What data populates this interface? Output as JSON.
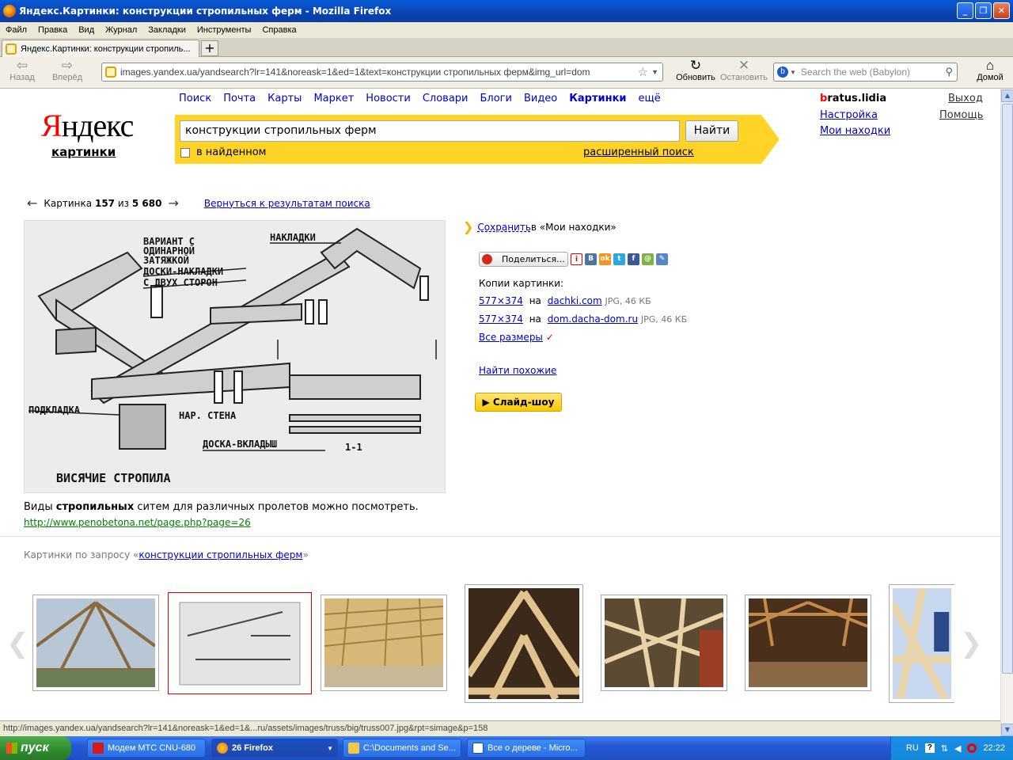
{
  "window": {
    "title": "Яндекс.Картинки: конструкции стропильных ферм - Mozilla Firefox",
    "controls": [
      "_",
      "❐",
      "✕"
    ]
  },
  "menu": [
    "Файл",
    "Правка",
    "Вид",
    "Журнал",
    "Закладки",
    "Инструменты",
    "Справка"
  ],
  "tab": {
    "label": "Яндекс.Картинки: конструкции стропиль...",
    "new_tab": "+"
  },
  "nav": {
    "back": "Назад",
    "forward": "Вперёд",
    "url": "images.yandex.ua/yandsearch?lr=141&noreask=1&ed=1&text=конструкции стропильных ферм&img_url=dom",
    "reload": "Обновить",
    "stop": "Остановить",
    "search_placeholder": "Search the web (Babylon)",
    "home": "Домой"
  },
  "yandex": {
    "logo_first": "Я",
    "logo_rest": "ндекс",
    "service": "картинки",
    "nav_links": [
      "Поиск",
      "Почта",
      "Карты",
      "Маркет",
      "Новости",
      "Словари",
      "Блоги",
      "Видео",
      "Картинки",
      "ещё"
    ],
    "query": "конструкции стропильных ферм",
    "search_button": "Найти",
    "in_found": "в найденном",
    "advanced": "расширенный поиск",
    "user_first": "b",
    "user_rest": "ratus.lidia",
    "settings": "Настройка",
    "my_finds": "Мои находки",
    "logout": "Выход",
    "help": "Помощь"
  },
  "pager": {
    "prev": "←",
    "label": "Картинка",
    "current": "157",
    "of": "из",
    "total": "5 680",
    "next": "→",
    "back_to_results": "Вернуться к результатам поиска"
  },
  "drawing": {
    "labels": [
      "ВАРИАНТ С",
      "ОДИНАРНОЙ",
      "ЗАТЯЖКОЙ",
      "ДОСКИ-НАКЛАДКИ",
      "С ДВУХ СТОРОН",
      "НАКЛАДКИ",
      "ПОДКЛАДКА",
      "НАР. СТЕНА",
      "ДОСКА-ВКЛАДЫШ",
      "1-1",
      "ВИСЯЧИЕ СТРОПИЛА"
    ]
  },
  "caption": {
    "before": "Виды ",
    "bold": "стропильных",
    "after": " ситем для различных пролетов можно посмотреть.",
    "url": "http://www.penobetona.net/page.php?page=26"
  },
  "actions": {
    "save": "Сохранить",
    "save_to": " в «Мои находки»",
    "share": "Поделиться...",
    "copies_title": "Копии картинки:",
    "copies": [
      {
        "size": "577×374",
        "on": "на",
        "site": "dachki.com",
        "meta": "JPG, 46 КБ"
      },
      {
        "size": "577×374",
        "on": "на",
        "site": "dom.dacha-dom.ru",
        "meta": "JPG, 46 КБ"
      }
    ],
    "all_sizes": "Все размеры",
    "similar": "Найти похожие",
    "slideshow": "▶ Слайд-шоу"
  },
  "related": {
    "prefix": "Картинки по запросу «",
    "query": "конструкции стропильных ферм",
    "suffix": "»"
  },
  "status": "http://images.yandex.ua/yandsearch?lr=141&noreask=1&ed=1&...ru/assets/images/truss/big/truss007.jpg&rpt=simage&p=158",
  "taskbar": {
    "start": "пуск",
    "items": [
      "Модем МТС CNU-680",
      "26 Firefox",
      "C:\\Documents and Se...",
      "Все о дереве - Micro..."
    ],
    "lang": "RU",
    "time": "22:22"
  },
  "colors": {
    "accent": "#ffd426",
    "link": "#0000cc",
    "brand_red": "#ff0000",
    "url_green": "#008000"
  }
}
